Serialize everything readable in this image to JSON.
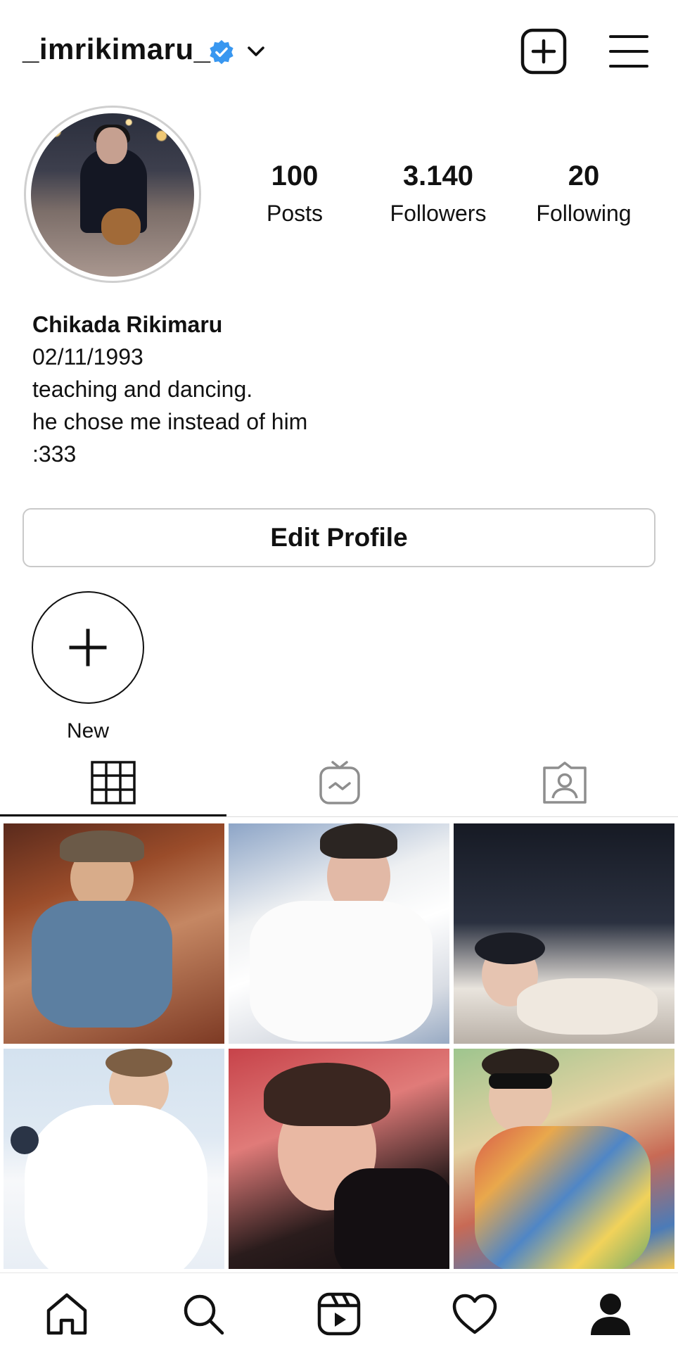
{
  "header": {
    "username": "_imrikimaru_",
    "verified_icon": "verified-badge-icon",
    "account_switch_icon": "chevron-down-icon",
    "new_post_icon": "plus-square-icon",
    "menu_icon": "hamburger-menu-icon"
  },
  "profile": {
    "avatar_icon": "profile-photo",
    "stats": {
      "posts": {
        "value": "100",
        "label": "Posts"
      },
      "followers": {
        "value": "3.140",
        "label": "Followers"
      },
      "following": {
        "value": "20",
        "label": "Following"
      }
    },
    "bio": {
      "name": "Chikada Rikimaru",
      "lines": [
        "02/11/1993",
        "teaching and dancing.",
        "he chose me instead of him",
        ":333"
      ]
    },
    "edit_profile_label": "Edit Profile"
  },
  "highlights": {
    "new_label": "New",
    "new_icon": "plus-icon"
  },
  "tabs": [
    {
      "name": "posts-grid",
      "icon": "grid-icon",
      "active": true
    },
    {
      "name": "igtv",
      "icon": "igtv-icon",
      "active": false
    },
    {
      "name": "tagged",
      "icon": "tagged-person-icon",
      "active": false
    }
  ],
  "posts": [
    {
      "icon": "photo-thumbnail"
    },
    {
      "icon": "photo-thumbnail"
    },
    {
      "icon": "photo-thumbnail"
    },
    {
      "icon": "photo-thumbnail"
    },
    {
      "icon": "photo-thumbnail"
    },
    {
      "icon": "photo-thumbnail"
    }
  ],
  "bottom_nav": [
    {
      "name": "home",
      "icon": "home-icon"
    },
    {
      "name": "search",
      "icon": "search-icon"
    },
    {
      "name": "reels",
      "icon": "reels-icon"
    },
    {
      "name": "activity",
      "icon": "heart-icon"
    },
    {
      "name": "profile",
      "icon": "profile-icon",
      "active": true
    }
  ],
  "colors": {
    "verified": "#3897f0",
    "text": "#111111",
    "border": "#c9c9c9",
    "divider": "#dbdbdb"
  }
}
